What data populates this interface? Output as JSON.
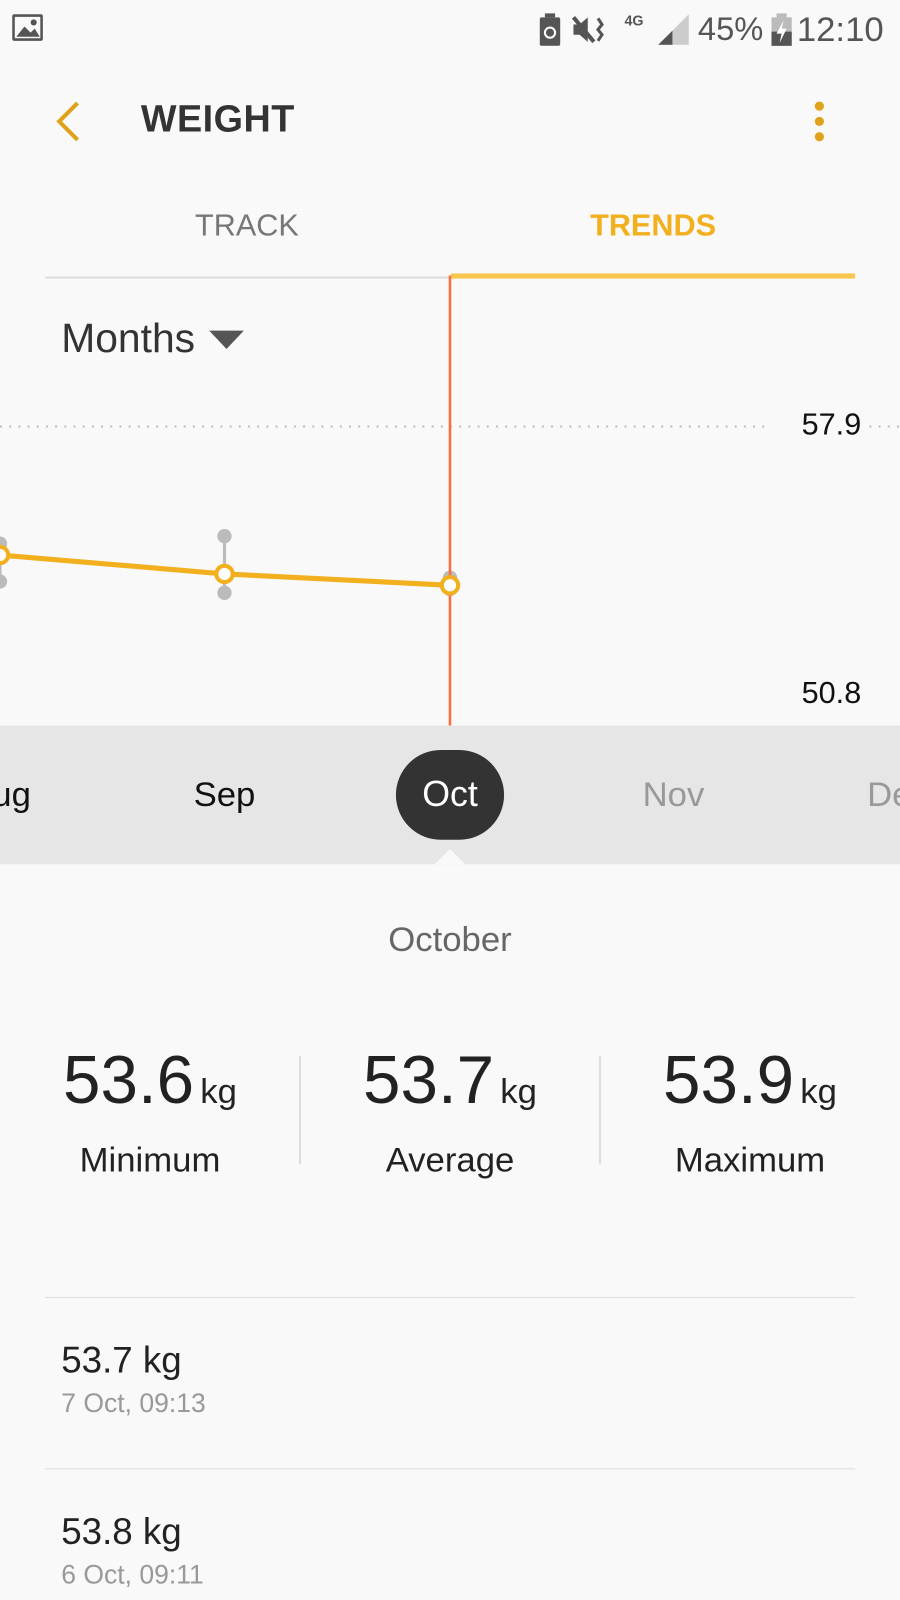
{
  "status_bar": {
    "battery": "45%",
    "time": "12:10",
    "network": "4G"
  },
  "header": {
    "title": "WEIGHT"
  },
  "tabs": [
    {
      "label": "TRACK",
      "active": false
    },
    {
      "label": "TRENDS",
      "active": true
    }
  ],
  "period_dropdown": {
    "selected": "Months"
  },
  "accent_color": "#f2b01e",
  "chart_data": {
    "type": "line",
    "y_tick_labels": [
      "57.9",
      "50.8"
    ],
    "ylim": [
      50.8,
      57.9
    ],
    "categories": [
      "Aug",
      "Sep",
      "Oct",
      "Nov",
      "Dec"
    ],
    "series": [
      {
        "kind": "average",
        "values": [
          54.5,
          54.0,
          53.7,
          null,
          null
        ]
      },
      {
        "kind": "minimum",
        "values": [
          53.8,
          53.5,
          53.6,
          null,
          null
        ]
      },
      {
        "kind": "maximum",
        "values": [
          54.8,
          55.0,
          53.9,
          null,
          null
        ]
      }
    ],
    "selected": "Oct"
  },
  "months": [
    "Aug",
    "Sep",
    "Oct",
    "Nov",
    "Dec"
  ],
  "summary": {
    "month": "October",
    "stats": [
      {
        "value": "53.6",
        "unit": "kg",
        "label": "Minimum"
      },
      {
        "value": "53.7",
        "unit": "kg",
        "label": "Average"
      },
      {
        "value": "53.9",
        "unit": "kg",
        "label": "Maximum"
      }
    ]
  },
  "entries": [
    {
      "weight": "53.7 kg",
      "date": "7 Oct, 09:13"
    },
    {
      "weight": "53.8 kg",
      "date": "6 Oct, 09:11"
    }
  ]
}
